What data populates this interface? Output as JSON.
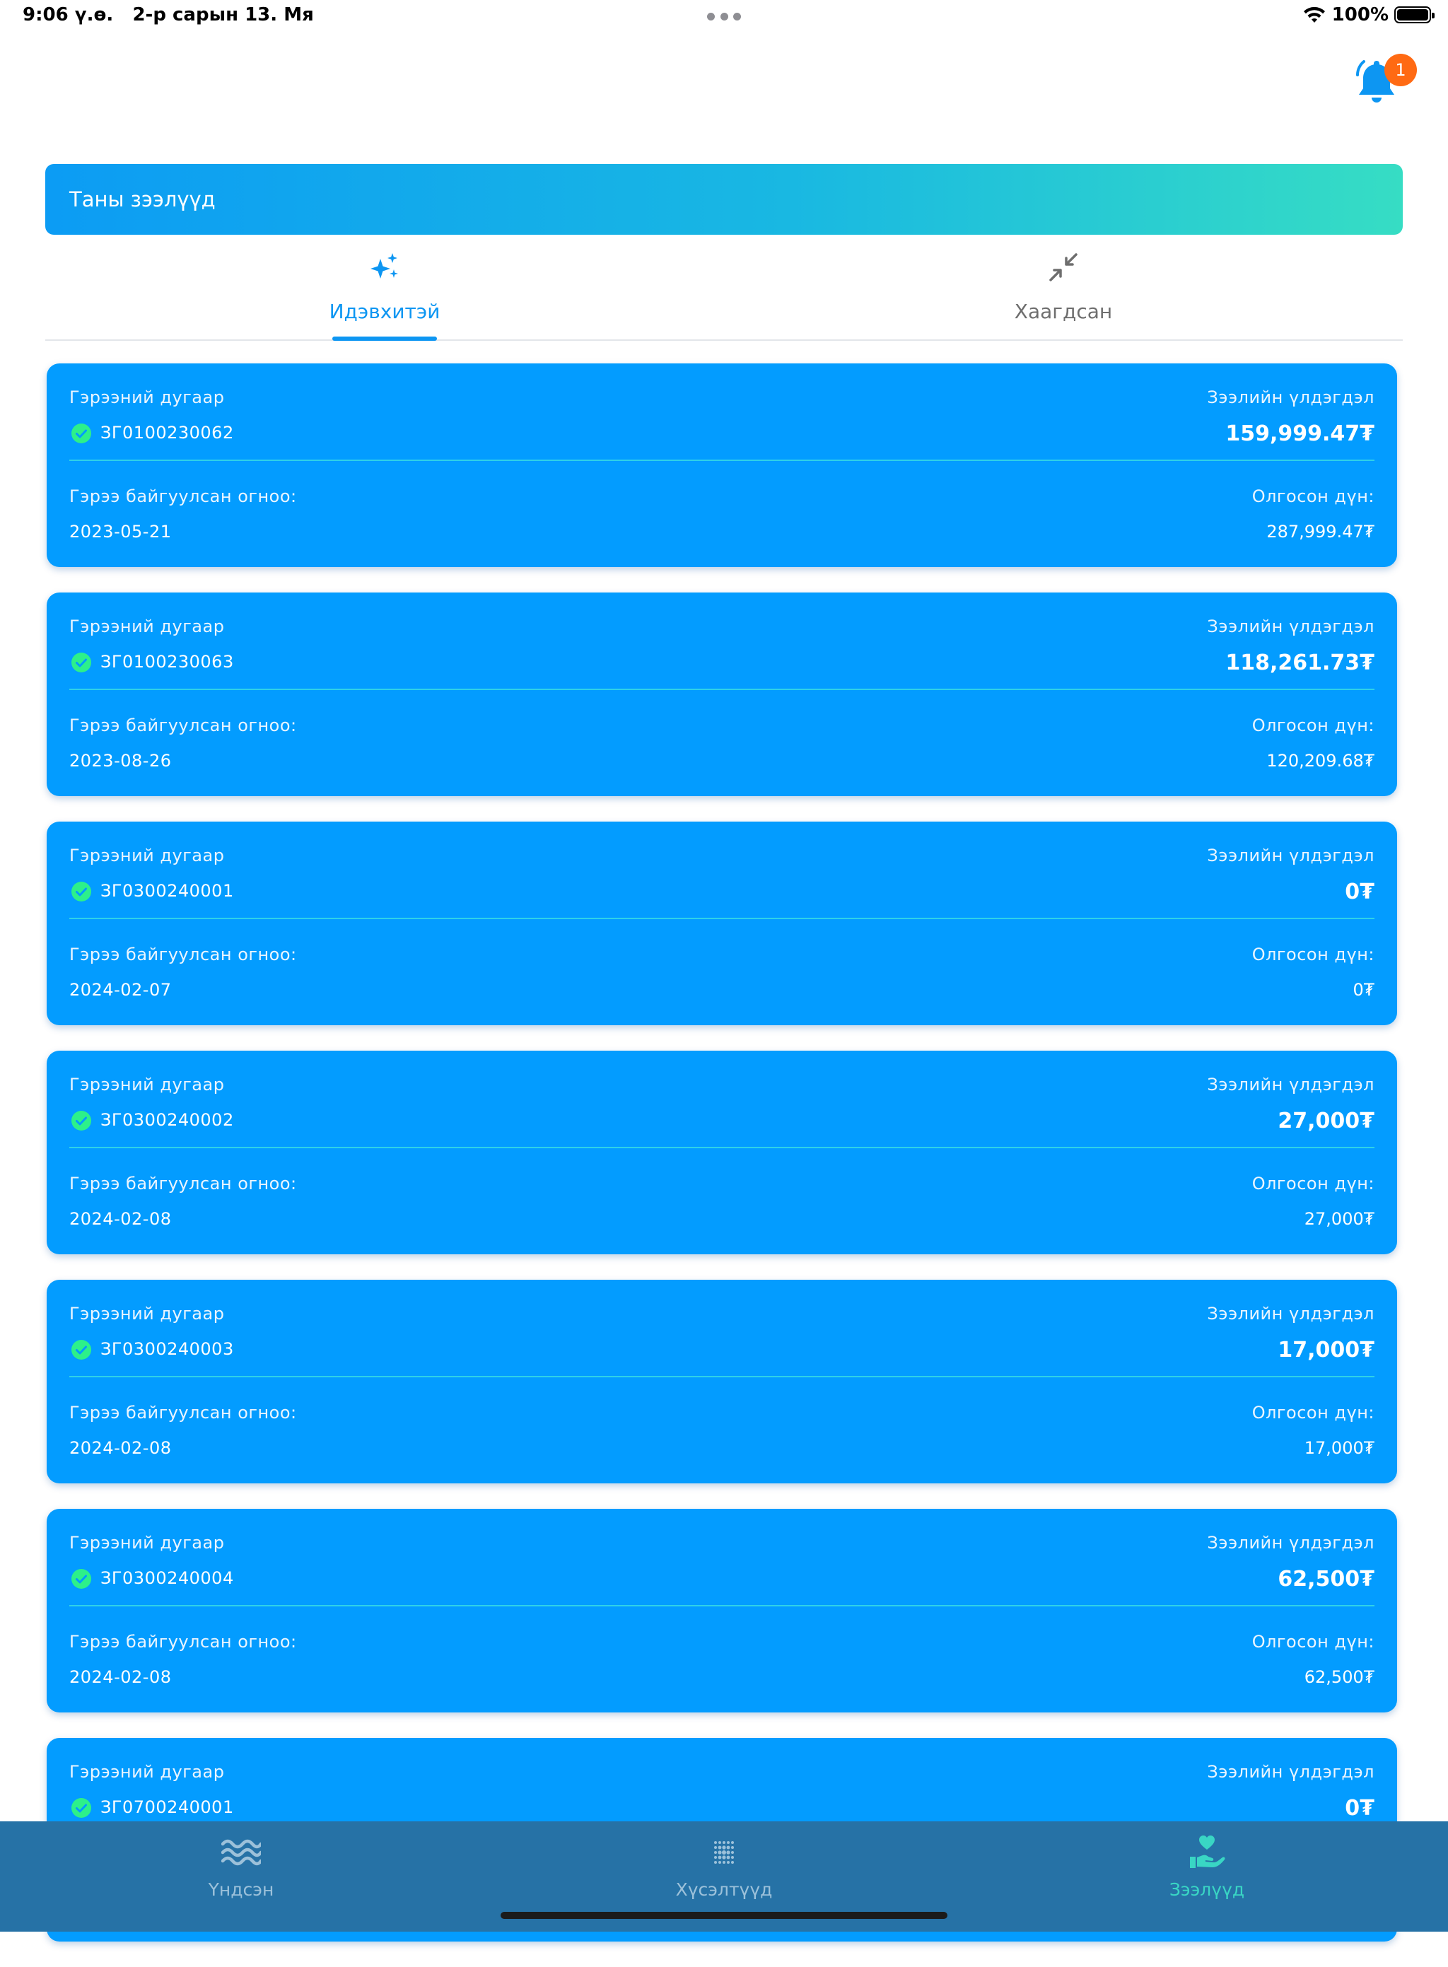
{
  "status_bar": {
    "time": "9:06 ү.ө.",
    "date": "2-р сарын 13. Мя",
    "battery": "100%"
  },
  "notifications": {
    "badge_count": "1"
  },
  "header": {
    "title": "Таны зээлүүд"
  },
  "tabs": [
    {
      "label": "Идэвхитэй",
      "icon": "sparkles-icon",
      "active": true
    },
    {
      "label": "Хаагдсан",
      "icon": "compress-arrows-icon",
      "active": false
    }
  ],
  "card_labels": {
    "contract_no": "Гэрээний дугаар",
    "balance": "Зээлийн үлдэгдэл",
    "contract_date": "Гэрээ байгуулсан огноо:",
    "issued_amount": "Олгосон дүн:"
  },
  "loans": [
    {
      "contract_no": "ЗГ0100230062",
      "balance": "159,999.47₮",
      "date": "2023-05-21",
      "issued": "287,999.47₮"
    },
    {
      "contract_no": "ЗГ0100230063",
      "balance": "118,261.73₮",
      "date": "2023-08-26",
      "issued": "120,209.68₮"
    },
    {
      "contract_no": "ЗГ0300240001",
      "balance": "0₮",
      "date": "2024-02-07",
      "issued": "0₮"
    },
    {
      "contract_no": "ЗГ0300240002",
      "balance": "27,000₮",
      "date": "2024-02-08",
      "issued": "27,000₮"
    },
    {
      "contract_no": "ЗГ0300240003",
      "balance": "17,000₮",
      "date": "2024-02-08",
      "issued": "17,000₮"
    },
    {
      "contract_no": "ЗГ0300240004",
      "balance": "62,500₮",
      "date": "2024-02-08",
      "issued": "62,500₮"
    },
    {
      "contract_no": "ЗГ0700240001",
      "balance": "0₮",
      "date": "",
      "issued": ""
    }
  ],
  "bottom_nav": [
    {
      "label": "Үндсэн",
      "icon": "waves-icon",
      "active": false
    },
    {
      "label": "Хүсэлтүүд",
      "icon": "dot-grid-icon",
      "active": false
    },
    {
      "label": "Зээлүүд",
      "icon": "heart-hand-icon",
      "active": true
    }
  ],
  "colors": {
    "primary": "#0D96F2",
    "card": "#039CFF",
    "accent_teal": "#39D6C4",
    "badge": "#FF6A13",
    "nav_bg": "#2672A6"
  }
}
